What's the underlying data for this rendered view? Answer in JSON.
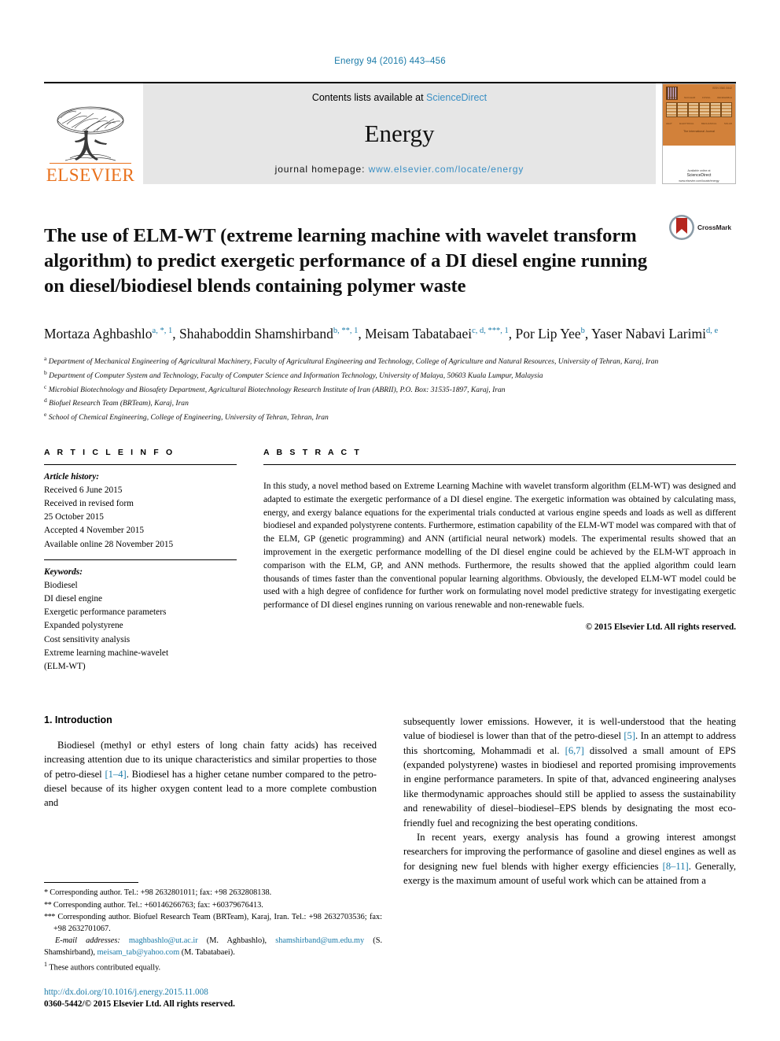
{
  "running_head": "Energy 94 (2016) 443–456",
  "masthead": {
    "publisher": "ELSEVIER",
    "contents_prefix": "Contents lists available at ",
    "contents_link": "ScienceDirect",
    "journal_name": "Energy",
    "homepage_prefix": "journal homepage: ",
    "homepage_url": "www.elsevier.com/locate/energy",
    "cover": {
      "title": "ENERGY",
      "subtitle": "The International Journal",
      "publisher_small": "Available online at",
      "publisher_name": "ScienceDirect",
      "issn_small": "www.elsevier.com/locate/energy",
      "col_labels": [
        "THERMAL",
        "NUCLEAR",
        "FOSSIL",
        "RENEWABLE"
      ],
      "col_labels2": [
        "HEAT",
        "ELECTRICAL",
        "MECHANICAL",
        "SOLAR"
      ],
      "corner_note": "ISSN 0360-5442"
    }
  },
  "article": {
    "title": "The use of ELM-WT (extreme learning machine with wavelet transform algorithm) to predict exergetic performance of a DI diesel engine running on diesel/biodiesel blends containing polymer waste",
    "crossmark_label": "CrossMark",
    "authors_line_1": "Mortaza Aghbashlo",
    "authors_line_1_sup": "a, *, 1",
    "author_2": "Shahaboddin Shamshirband",
    "author_2_sup": "b, **, 1",
    "author_3": "Meisam Tabatabaei",
    "author_3_sup": "c, d, ***, 1",
    "author_4": "Por Lip Yee",
    "author_4_sup": "b",
    "author_5": "Yaser Nabavi Larimi",
    "author_5_sup": "d, e",
    "affiliations": [
      {
        "mark": "a",
        "text": "Department of Mechanical Engineering of Agricultural Machinery, Faculty of Agricultural Engineering and Technology, College of Agriculture and Natural Resources, University of Tehran, Karaj, Iran"
      },
      {
        "mark": "b",
        "text": "Department of Computer System and Technology, Faculty of Computer Science and Information Technology, University of Malaya, 50603 Kuala Lumpur, Malaysia"
      },
      {
        "mark": "c",
        "text": "Microbial Biotechnology and Biosafety Department, Agricultural Biotechnology Research Institute of Iran (ABRII), P.O. Box: 31535-1897, Karaj, Iran"
      },
      {
        "mark": "d",
        "text": "Biofuel Research Team (BRTeam), Karaj, Iran"
      },
      {
        "mark": "e",
        "text": "School of Chemical Engineering, College of Engineering, University of Tehran, Tehran, Iran"
      }
    ]
  },
  "article_info": {
    "heading": "A R T I C L E   I N F O",
    "history_label": "Article history:",
    "history": [
      "Received 6 June 2015",
      "Received in revised form",
      "25 October 2015",
      "Accepted 4 November 2015",
      "Available online 28 November 2015"
    ],
    "keywords_label": "Keywords:",
    "keywords": [
      "Biodiesel",
      "DI diesel engine",
      "Exergetic performance parameters",
      "Expanded polystyrene",
      "Cost sensitivity analysis",
      "Extreme learning machine-wavelet",
      "(ELM-WT)"
    ]
  },
  "abstract": {
    "heading": "A B S T R A C T",
    "text": "In this study, a novel method based on Extreme Learning Machine with wavelet transform algorithm (ELM-WT) was designed and adapted to estimate the exergetic performance of a DI diesel engine. The exergetic information was obtained by calculating mass, energy, and exergy balance equations for the experimental trials conducted at various engine speeds and loads as well as different biodiesel and expanded polystyrene contents. Furthermore, estimation capability of the ELM-WT model was compared with that of the ELM, GP (genetic programming) and ANN (artificial neural network) models. The experimental results showed that an improvement in the exergetic performance modelling of the DI diesel engine could be achieved by the ELM-WT approach in comparison with the ELM, GP, and ANN methods. Furthermore, the results showed that the applied algorithm could learn thousands of times faster than the conventional popular learning algorithms. Obviously, the developed ELM-WT model could be used with a high degree of confidence for further work on formulating novel model predictive strategy for investigating exergetic performance of DI diesel engines running on various renewable and non-renewable fuels.",
    "copyright": "© 2015 Elsevier Ltd. All rights reserved."
  },
  "body": {
    "section_number_title": "1. Introduction",
    "left_para_1_a": "Biodiesel (methyl or ethyl esters of long chain fatty acids) has received increasing attention due to its unique characteristics and similar properties to those of petro-diesel ",
    "left_cite_1": "[1–4]",
    "left_para_1_b": ". Biodiesel has a higher cetane number compared to the petro-diesel because of its higher oxygen content lead to a more complete combustion and",
    "right_para_1_a": "subsequently lower emissions. However, it is well-understood that the heating value of biodiesel is lower than that of the petro-diesel ",
    "right_cite_1": "[5]",
    "right_para_1_b": ". In an attempt to address this shortcoming, Mohammadi et al. ",
    "right_cite_2": "[6,7]",
    "right_para_1_c": " dissolved a small amount of EPS (expanded polystyrene) wastes in biodiesel and reported promising improvements in engine performance parameters. In spite of that, advanced engineering analyses like thermodynamic approaches should still be applied to assess the sustainability and renewability of diesel–biodiesel–EPS blends by designating the most eco-friendly fuel and recognizing the best operating conditions.",
    "right_para_2_a": "In recent years, exergy analysis has found a growing interest amongst researchers for improving the performance of gasoline and diesel engines as well as for designing new fuel blends with higher exergy efficiencies ",
    "right_cite_3": "[8–11]",
    "right_para_2_b": ". Generally, exergy is the maximum amount of useful work which can be attained from a"
  },
  "footnotes": {
    "corresponding_1": "Corresponding author. Tel.: +98 2632801011; fax: +98 2632808138.",
    "corresponding_1_mark": "*",
    "corresponding_2": "Corresponding author. Tel.: +60146266763; fax: +60379676413.",
    "corresponding_2_mark": "**",
    "corresponding_3": "Corresponding author. Biofuel Research Team (BRTeam), Karaj, Iran. Tel.: +98 2632703536; fax: +98 2632701067.",
    "corresponding_3_mark": "***",
    "email_label": "E-mail addresses:",
    "email_1": "maghbashlo@ut.ac.ir",
    "email_1_owner": " (M. Aghbashlo), ",
    "email_2": "shamshirband@um.edu.my",
    "email_2_owner": " (S. Shamshirband), ",
    "email_3": "meisam_tab@yahoo.com",
    "email_3_owner": " (M. Tabatabaei).",
    "equal_mark": "1",
    "equal_contrib": "These authors contributed equally.",
    "doi": "http://dx.doi.org/10.1016/j.energy.2015.11.008",
    "issn": "0360-5442/© 2015 Elsevier Ltd. All rights reserved."
  },
  "colors": {
    "link_blue": "#1a7aa8",
    "elsevier_orange": "#E9711C",
    "masthead_gray": "#e6e6e6",
    "cover_orange": "#d2813a",
    "crossmark_red": "#b5261e"
  }
}
